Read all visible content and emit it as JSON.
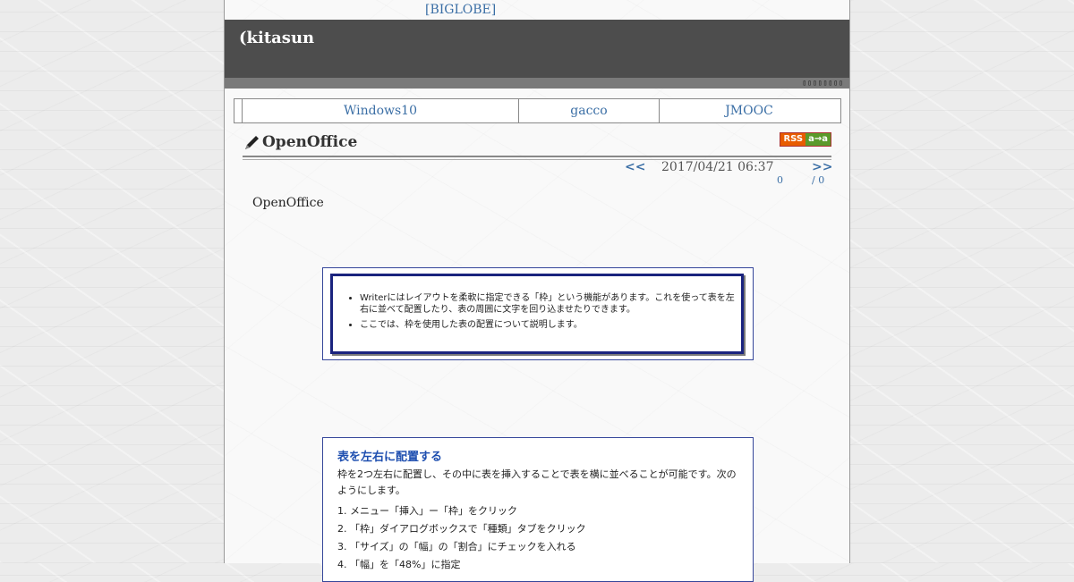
{
  "top_link": "[BIGLOBE]",
  "blog_title": "(kitasun",
  "strip_text": "▯▯▯▯▯▯▯▯",
  "nav": [
    "Windows10",
    "gacco",
    "JMOOC"
  ],
  "entry": {
    "title": "OpenOffice",
    "rss_label": "RSS",
    "rss_sub": "a→a",
    "prev": "<<",
    "datetime": "2017/04/21 06:37",
    "next": ">>",
    "count_a": "0",
    "count_b": "/ 0",
    "body": "OpenOffice"
  },
  "shot1": {
    "items": [
      "Writerにはレイアウトを柔軟に指定できる「枠」という機能があります。これを使って表を左右に並べて配置したり、表の周囲に文字を回り込ませたりできます。",
      "ここでは、枠を使用した表の配置について説明します。"
    ]
  },
  "shot2": {
    "heading": "表を左右に配置する",
    "intro": "枠を2つ左右に配置し、その中に表を挿入することで表を横に並べることが可能です。次のようにします。",
    "steps": [
      "1. メニュー「挿入」ー「枠」をクリック",
      "2. 「枠」ダイアログボックスで「種類」タブをクリック",
      "3. 「サイズ」の「幅」の「割合」にチェックを入れる",
      "4. 「幅」を「48%」に指定"
    ]
  },
  "colors": {
    "header_band": "#4d4d4d",
    "link": "#3a6ea5",
    "screenshot_border": "#1a237e",
    "screenshot_heading": "#1f4fb0"
  }
}
